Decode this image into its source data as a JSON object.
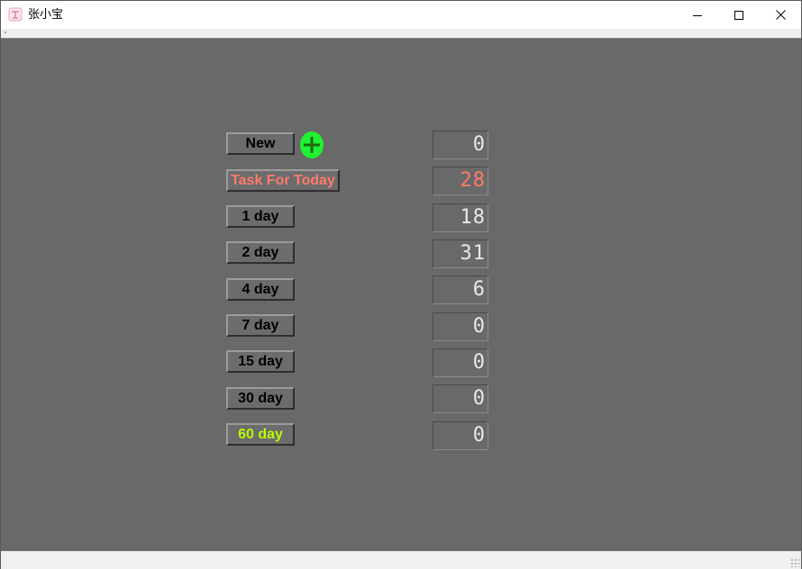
{
  "window": {
    "title": "张小宝"
  },
  "title_controls": {
    "minimize_icon": "minimize-icon",
    "maximize_icon": "maximize-icon",
    "close_icon": "close-icon"
  },
  "colors": {
    "client_bg": "#696969",
    "task_today": "#ff7b6b",
    "sixty_day": "#b6ff00",
    "plus_button": "#1ef232",
    "counter_text": "#e8e8e8"
  },
  "rows": [
    {
      "label": "New",
      "color": "#000000",
      "count": "0"
    },
    {
      "label": "Task For Today",
      "color": "#ff7b6b",
      "count": "28"
    },
    {
      "label": "1 day",
      "color": "#000000",
      "count": "18"
    },
    {
      "label": "2 day",
      "color": "#000000",
      "count": "31"
    },
    {
      "label": "4 day",
      "color": "#000000",
      "count": "6"
    },
    {
      "label": "7 day",
      "color": "#000000",
      "count": "0"
    },
    {
      "label": "15 day",
      "color": "#000000",
      "count": "0"
    },
    {
      "label": "30 day",
      "color": "#000000",
      "count": "0"
    },
    {
      "label": "60 day",
      "color": "#b6ff00",
      "count": "0"
    }
  ],
  "add_button": {
    "icon": "plus-icon"
  }
}
